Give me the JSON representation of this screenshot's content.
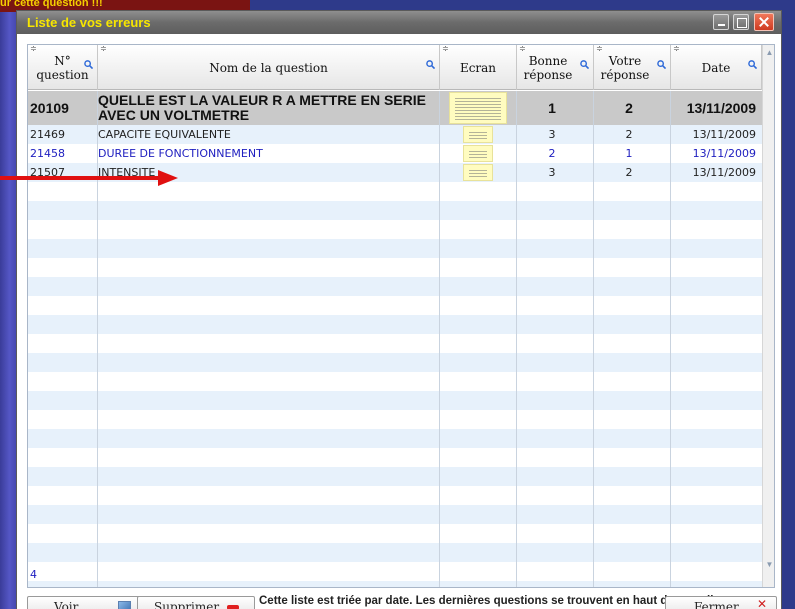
{
  "background": {
    "banner_text": "ur cette question !!!"
  },
  "window": {
    "title": "Liste de vos erreurs"
  },
  "columns": [
    {
      "label": "N° question",
      "sortable": true,
      "searchable": true
    },
    {
      "label": "Nom de la question",
      "sortable": true,
      "searchable": true
    },
    {
      "label": "Ecran",
      "sortable": true,
      "searchable": false
    },
    {
      "label": "Bonne réponse",
      "sortable": true,
      "searchable": true
    },
    {
      "label": "Votre réponse",
      "sortable": true,
      "searchable": true
    },
    {
      "label": "Date",
      "sortable": true,
      "searchable": true
    }
  ],
  "rows": [
    {
      "num": "20109",
      "name": "QUELLE EST LA VALEUR R A METTRE EN SERIE AVEC UN VOLTMETRE",
      "good": "1",
      "yours": "2",
      "date": "13/11/2009",
      "state": "selected"
    },
    {
      "num": "21469",
      "name": "CAPACITE EQUIVALENTE",
      "good": "3",
      "yours": "2",
      "date": "13/11/2009",
      "state": "normal"
    },
    {
      "num": "21458",
      "name": "DUREE DE FONCTIONNEMENT",
      "good": "2",
      "yours": "1",
      "date": "13/11/2009",
      "state": "blue"
    },
    {
      "num": "21507",
      "name": "INTENSITE",
      "good": "3",
      "yours": "2",
      "date": "13/11/2009",
      "state": "normal"
    }
  ],
  "list_count": "4",
  "footer": {
    "voir_label": "Voir",
    "supprimer_label": "Supprimer",
    "note": "Cette liste est triée par date. Les dernières questions se trouvent en haut de cette liste.",
    "fermer_label": "Fermer"
  },
  "colors": {
    "title_text": "#f7e600",
    "arrow": "#e01010",
    "selected_row": "#c9c9c9",
    "alt_row": "#e7f1fb",
    "link_blue": "#2020c0"
  }
}
